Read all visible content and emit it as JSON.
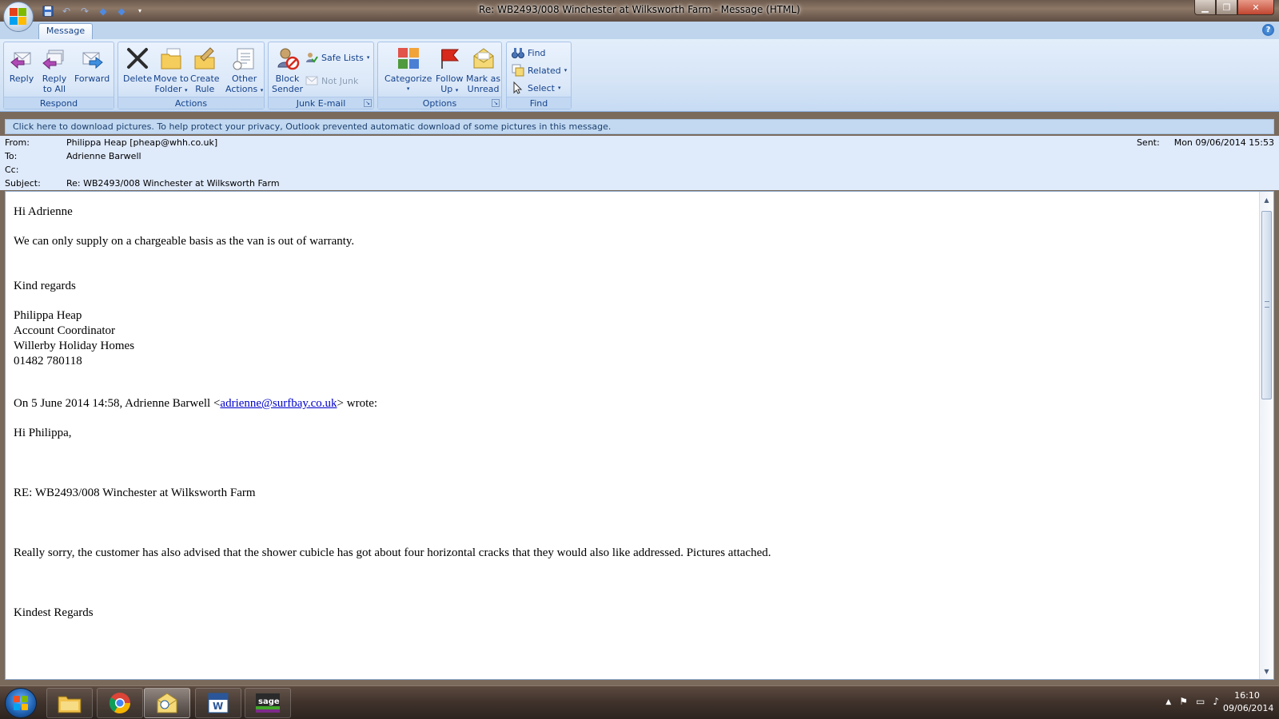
{
  "window": {
    "title": "Re: WB2493/008 Winchester at Wilksworth Farm - Message (HTML)"
  },
  "ribbon": {
    "tab": "Message",
    "groups": {
      "respond": {
        "label": "Respond",
        "reply": "Reply",
        "reply_all_1": "Reply",
        "reply_all_2": "to All",
        "forward": "Forward"
      },
      "actions": {
        "label": "Actions",
        "delete": "Delete",
        "move_1": "Move to",
        "move_2": "Folder",
        "rule_1": "Create",
        "rule_2": "Rule",
        "other_1": "Other",
        "other_2": "Actions"
      },
      "junk": {
        "label": "Junk E-mail",
        "block_1": "Block",
        "block_2": "Sender",
        "safe_lists": "Safe Lists",
        "not_junk": "Not Junk"
      },
      "options": {
        "label": "Options",
        "categorize": "Categorize",
        "follow_1": "Follow",
        "follow_2": "Up",
        "mark_1": "Mark as",
        "mark_2": "Unread"
      },
      "find": {
        "label": "Find",
        "find": "Find",
        "related": "Related",
        "select": "Select"
      }
    }
  },
  "infobar": "Click here to download pictures. To help protect your privacy, Outlook prevented automatic download of some pictures in this message.",
  "header": {
    "from_label": "From:",
    "from": "Philippa Heap [pheap@whh.co.uk]",
    "to_label": "To:",
    "to": "Adrienne Barwell",
    "cc_label": "Cc:",
    "cc": "",
    "subject_label": "Subject:",
    "subject": "Re: WB2493/008 Winchester at Wilksworth Farm",
    "sent_label": "Sent:",
    "sent": "Mon 09/06/2014 15:53"
  },
  "body": {
    "greeting": "Hi Adrienne",
    "line1": "We can only supply on a chargeable basis as the van is out of warranty.",
    "regards": "Kind regards",
    "sig_name": "Philippa Heap",
    "sig_title": "Account Coordinator",
    "sig_company": "Willerby Holiday Homes",
    "sig_phone": "01482 780118",
    "quote_prefix": "On 5 June 2014 14:58, Adrienne Barwell <",
    "quote_email": "adrienne@surfbay.co.uk",
    "quote_suffix": "> wrote:",
    "q_greeting": "Hi Philippa,",
    "q_re": "RE: WB2493/008 Winchester at Wilksworth Farm",
    "q_body": "Really sorry, the customer has also advised that the shower cubicle has got about four horizontal cracks that they would also like addressed.  Pictures attached.",
    "q_regards": "Kindest Regards"
  },
  "taskbar": {
    "time": "16:10",
    "date": "09/06/2014"
  }
}
